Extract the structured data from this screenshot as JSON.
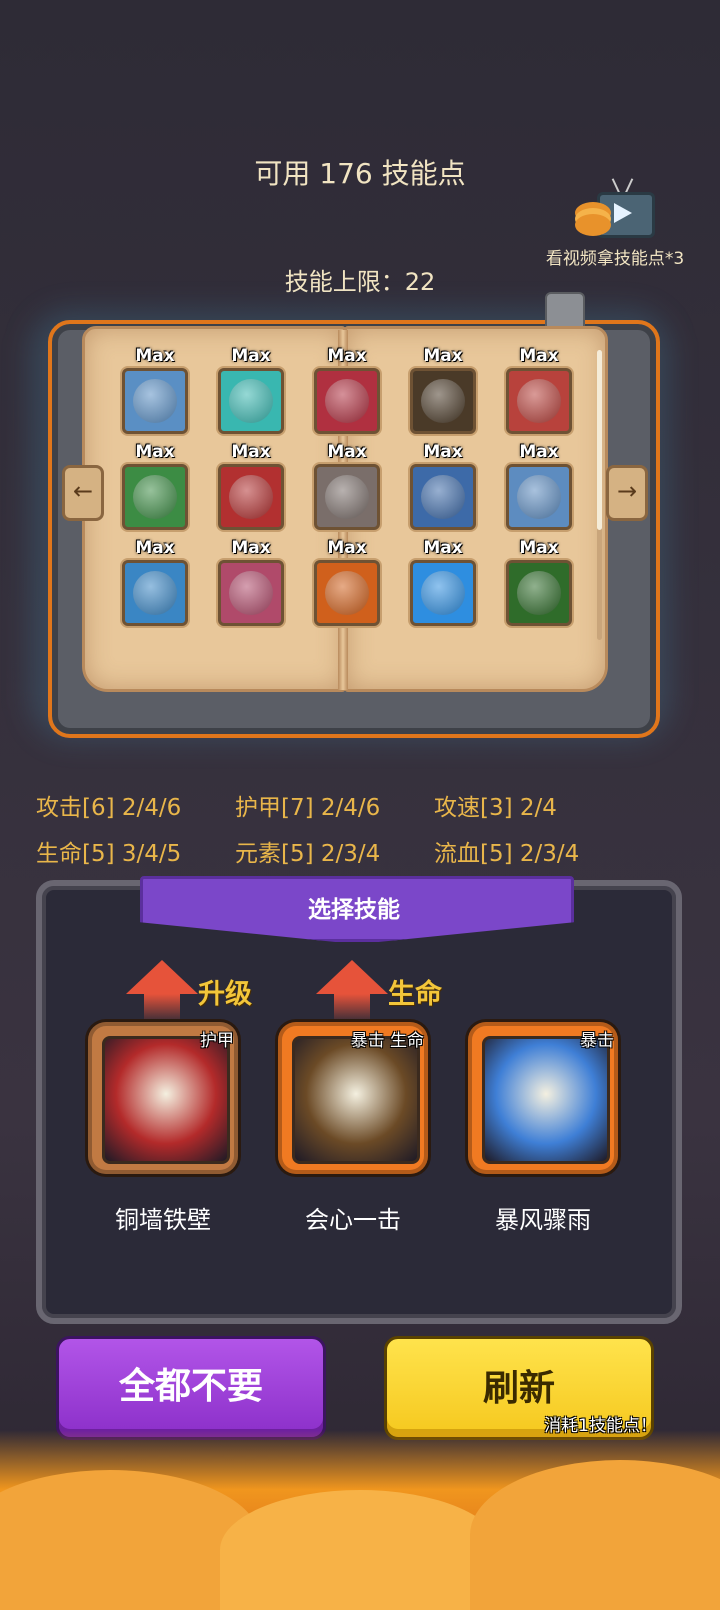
{
  "header": {
    "points_label": "可用 176 技能点",
    "limit_label": "技能上限：22",
    "video_label": "看视频拿技能点*3"
  },
  "icons": {
    "video": "tv-play-icon",
    "coins": "coin-stack-icon",
    "prev": "arrow-left-icon",
    "next": "arrow-right-icon",
    "upgrade": "arrow-up-icon"
  },
  "book": {
    "slots": [
      {
        "level": "Max",
        "icon": "water-spirit-icon",
        "color": "#5a8fc4"
      },
      {
        "level": "Max",
        "icon": "teal-figure-icon",
        "color": "#39b7b0"
      },
      {
        "level": "Max",
        "icon": "red-caped-figure-icon",
        "color": "#b03040"
      },
      {
        "level": "Max",
        "icon": "dark-blob-icon",
        "color": "#4a3a28"
      },
      {
        "level": "Max",
        "icon": "shark-red-icon",
        "color": "#b8423c"
      },
      {
        "level": "Max",
        "icon": "green-vines-icon",
        "color": "#3c8c44"
      },
      {
        "level": "Max",
        "icon": "shield-burst-icon",
        "color": "#b23030"
      },
      {
        "level": "Max",
        "icon": "shark-grin-icon",
        "color": "#7a6e6a"
      },
      {
        "level": "Max",
        "icon": "rain-storm-icon",
        "color": "#3d6aa8"
      },
      {
        "level": "Max",
        "icon": "blue-shark-icon",
        "color": "#5d8cc0"
      },
      {
        "level": "Max",
        "icon": "wooden-shield-icon",
        "color": "#3a86c4"
      },
      {
        "level": "Max",
        "icon": "pink-sack-icon",
        "color": "#b04a6a"
      },
      {
        "level": "Max",
        "icon": "orange-figure-icon",
        "color": "#d0601c"
      },
      {
        "level": "Max",
        "icon": "holy-cross-icon",
        "color": "#2e8ee0"
      },
      {
        "level": "Max",
        "icon": "brown-creature-icon",
        "color": "#2f6c2a"
      }
    ]
  },
  "stats": [
    {
      "text": "攻击[6] 2/4/6"
    },
    {
      "text": "护甲[7] 2/4/6"
    },
    {
      "text": "攻速[3] 2/4"
    },
    {
      "text": "生命[5] 3/4/5"
    },
    {
      "text": "元素[5] 2/3/4"
    },
    {
      "text": "流血[5] 2/3/4"
    }
  ],
  "panel": {
    "title": "选择技能",
    "cards": [
      {
        "name": "铜墙铁壁",
        "tag": "护甲",
        "upgrade": "升级",
        "border": "#c17a43",
        "art": "shield-burst-icon",
        "art_color": "#b32a2a"
      },
      {
        "name": "会心一击",
        "tag": "暴击 生命",
        "upgrade": "生命",
        "border": "#f07a22",
        "art": "archer-icon",
        "art_color": "#6b4a26"
      },
      {
        "name": "暴风骤雨",
        "tag": "暴击",
        "upgrade": "",
        "border": "#f07a22",
        "art": "meteor-shower-icon",
        "art_color": "#3f7fd6"
      }
    ]
  },
  "buttons": {
    "skip_all": "全都不要",
    "refresh": "刷新",
    "refresh_cost": "消耗1技能点！"
  }
}
